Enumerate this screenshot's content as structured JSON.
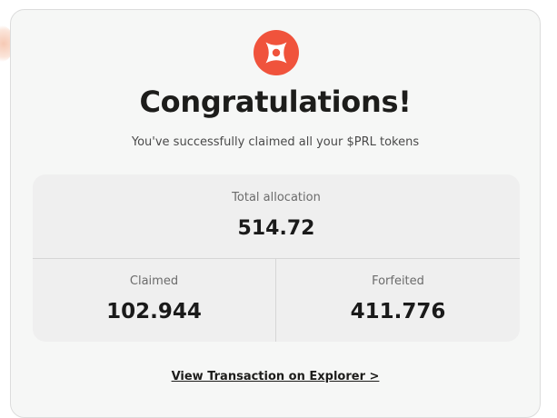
{
  "logo": {
    "icon": "prl-logo-icon",
    "color": "#f0533c"
  },
  "title": "Congratulations!",
  "subtitle": "You've successfully claimed all your $PRL tokens",
  "stats": {
    "total": {
      "label": "Total allocation",
      "value": "514.72"
    },
    "claimed": {
      "label": "Claimed",
      "value": "102.944"
    },
    "forfeited": {
      "label": "Forfeited",
      "value": "411.776"
    }
  },
  "link": {
    "label": "View Transaction on Explorer >"
  }
}
